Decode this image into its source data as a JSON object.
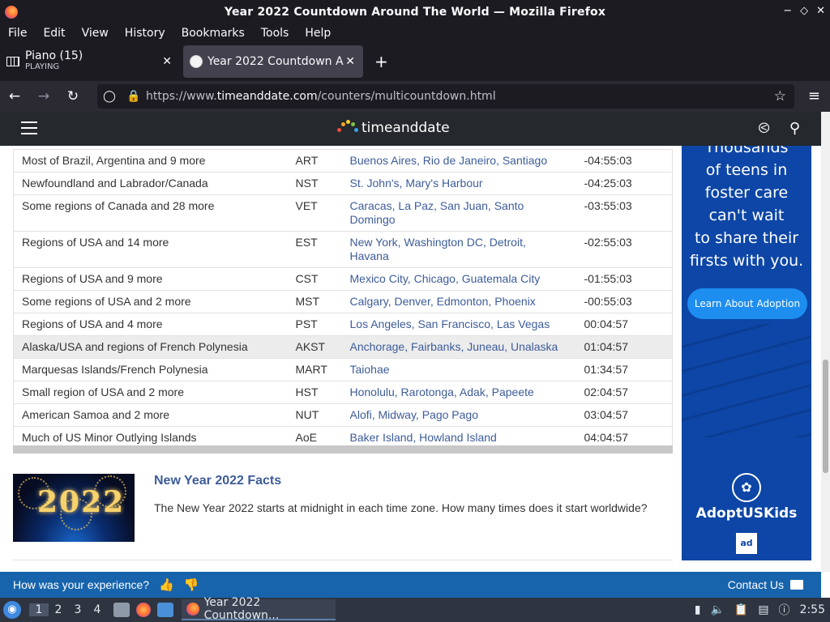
{
  "window": {
    "title": "Year 2022 Countdown Around The World — Mozilla Firefox"
  },
  "menu": [
    "File",
    "Edit",
    "View",
    "History",
    "Bookmarks",
    "Tools",
    "Help"
  ],
  "tabs": [
    {
      "title": "Piano (15)",
      "subtitle": "PLAYING"
    },
    {
      "title": "Year 2022 Countdown Around The World"
    }
  ],
  "nav": {
    "url_prefix": "https://www.",
    "url_domain": "timeanddate.com",
    "url_path": "/counters/multicountdown.html"
  },
  "site": {
    "logo_text": "timeanddate"
  },
  "table": {
    "rows": [
      {
        "region": "Most of Brazil, Argentina and 9 more",
        "abbr": "ART",
        "cities": "Buenos Aires, Rio de Janeiro, Santiago",
        "time": "-04:55:03",
        "highlight": false
      },
      {
        "region": "Newfoundland and Labrador/Canada",
        "abbr": "NST",
        "cities": "St. John's, Mary's Harbour",
        "time": "-04:25:03",
        "highlight": false
      },
      {
        "region": "Some regions of Canada and 28 more",
        "abbr": "VET",
        "cities": "Caracas, La Paz, San Juan, Santo Domingo",
        "time": "-03:55:03",
        "highlight": false
      },
      {
        "region": "Regions of USA and 14 more",
        "abbr": "EST",
        "cities": "New York, Washington DC, Detroit, Havana",
        "time": "-02:55:03",
        "highlight": false
      },
      {
        "region": "Regions of USA and 9 more",
        "abbr": "CST",
        "cities": "Mexico City, Chicago, Guatemala City",
        "time": "-01:55:03",
        "highlight": false
      },
      {
        "region": "Some regions of USA and 2 more",
        "abbr": "MST",
        "cities": "Calgary, Denver, Edmonton, Phoenix",
        "time": "-00:55:03",
        "highlight": false
      },
      {
        "region": "Regions of USA and 4 more",
        "abbr": "PST",
        "cities": "Los Angeles, San Francisco, Las Vegas",
        "time": "00:04:57",
        "highlight": false
      },
      {
        "region": "Alaska/USA and regions of French Polynesia",
        "abbr": "AKST",
        "cities": "Anchorage, Fairbanks, Juneau, Unalaska",
        "time": "01:04:57",
        "highlight": true
      },
      {
        "region": "Marquesas Islands/French Polynesia",
        "abbr": "MART",
        "cities": "Taiohae",
        "time": "01:34:57",
        "highlight": false
      },
      {
        "region": "Small region of USA and 2 more",
        "abbr": "HST",
        "cities": "Honolulu, Rarotonga, Adak, Papeete",
        "time": "02:04:57",
        "highlight": false
      },
      {
        "region": "American Samoa and 2 more",
        "abbr": "NUT",
        "cities": "Alofi, Midway, Pago Pago",
        "time": "03:04:57",
        "highlight": false
      },
      {
        "region": "Much of US Minor Outlying Islands",
        "abbr": "AoE",
        "cities": "Baker Island, Howland Island",
        "time": "04:04:57",
        "highlight": false
      }
    ]
  },
  "facts": {
    "image_text": "2022",
    "title": "New Year 2022 Facts",
    "desc": "The New Year 2022 starts at midnight in each time zone. How many times does it start worldwide?"
  },
  "ad": {
    "line1": "Thousands",
    "line2": "of teens in",
    "line3": "foster care",
    "line4": "can't wait",
    "line5": "to share their",
    "line6": "firsts with you.",
    "button": "Learn About Adoption",
    "brand": "AdoptUSKids",
    "badge": "ad"
  },
  "feedback": {
    "question": "How was your experience?",
    "contact": "Contact Us"
  },
  "taskbar": {
    "workspaces": [
      "1",
      "2",
      "3",
      "4"
    ],
    "task_title": "Year 2022 Countdown...",
    "clock": "2:55"
  },
  "colors": {
    "link": "#3d5c99",
    "accent_blue": "#1764ad",
    "ad_blue": "#0d46a6"
  }
}
